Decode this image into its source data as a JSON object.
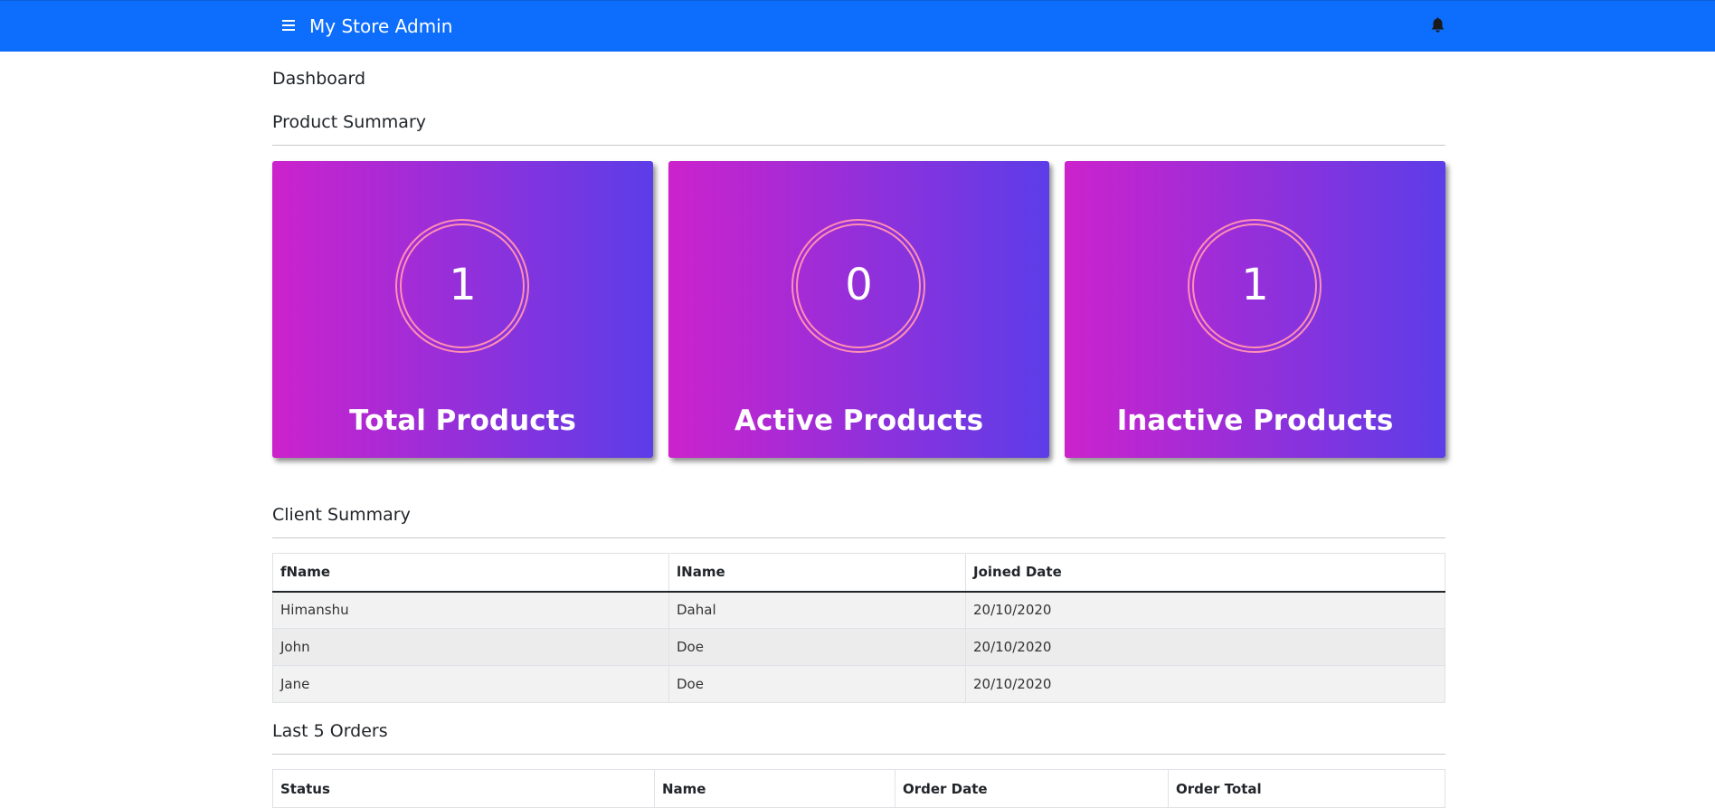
{
  "header": {
    "title": "My Store Admin",
    "menu_icon": "hamburger-menu-icon",
    "bell_icon": "bell-icon",
    "bg_color": "#0d6efd"
  },
  "page": {
    "title": "Dashboard"
  },
  "product_summary": {
    "title": "Product Summary",
    "gradient": [
      "#cc22cc",
      "#5c3de8"
    ],
    "ring_color": "#ff8fb3",
    "cards": [
      {
        "value": "1",
        "label": "Total Products"
      },
      {
        "value": "0",
        "label": "Active Products"
      },
      {
        "value": "1",
        "label": "Inactive Products"
      }
    ]
  },
  "client_summary": {
    "title": "Client Summary",
    "columns": [
      "fName",
      "lName",
      "Joined Date"
    ],
    "rows": [
      [
        "Himanshu",
        "Dahal",
        "20/10/2020"
      ],
      [
        "John",
        "Doe",
        "20/10/2020"
      ],
      [
        "Jane",
        "Doe",
        "20/10/2020"
      ]
    ]
  },
  "last_orders": {
    "title": "Last 5 Orders",
    "columns": [
      "Status",
      "Name",
      "Order Date",
      "Order Total"
    ]
  }
}
